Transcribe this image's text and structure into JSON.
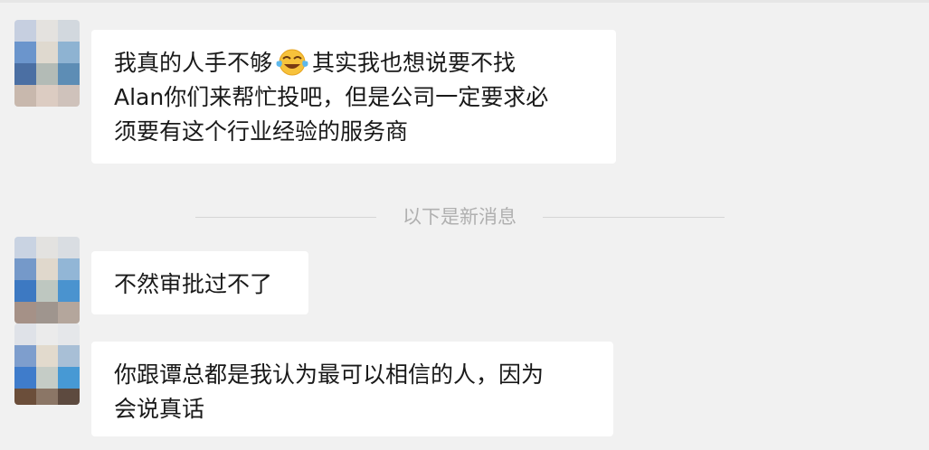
{
  "messages": [
    {
      "lines": [
        "我真的人手不够",
        "其实我也想说要不找",
        "Alan你们来帮忙投吧，但是公司一定要求必",
        "须要有这个行业经验的服务商"
      ],
      "emoji": "face-with-tears-of-joy-emoji"
    },
    {
      "lines": [
        "不然审批过不了"
      ]
    },
    {
      "lines": [
        "你跟谭总都是我认为最可以相信的人，因为",
        "会说真话"
      ]
    }
  ],
  "divider": {
    "label": "以下是新消息"
  },
  "icons": {
    "avatar": "pixelated-avatar-icon"
  },
  "colors": {
    "background": "#f1f1f1",
    "bubble": "#ffffff",
    "text": "#191919",
    "divider_text": "#b0b0b0"
  }
}
